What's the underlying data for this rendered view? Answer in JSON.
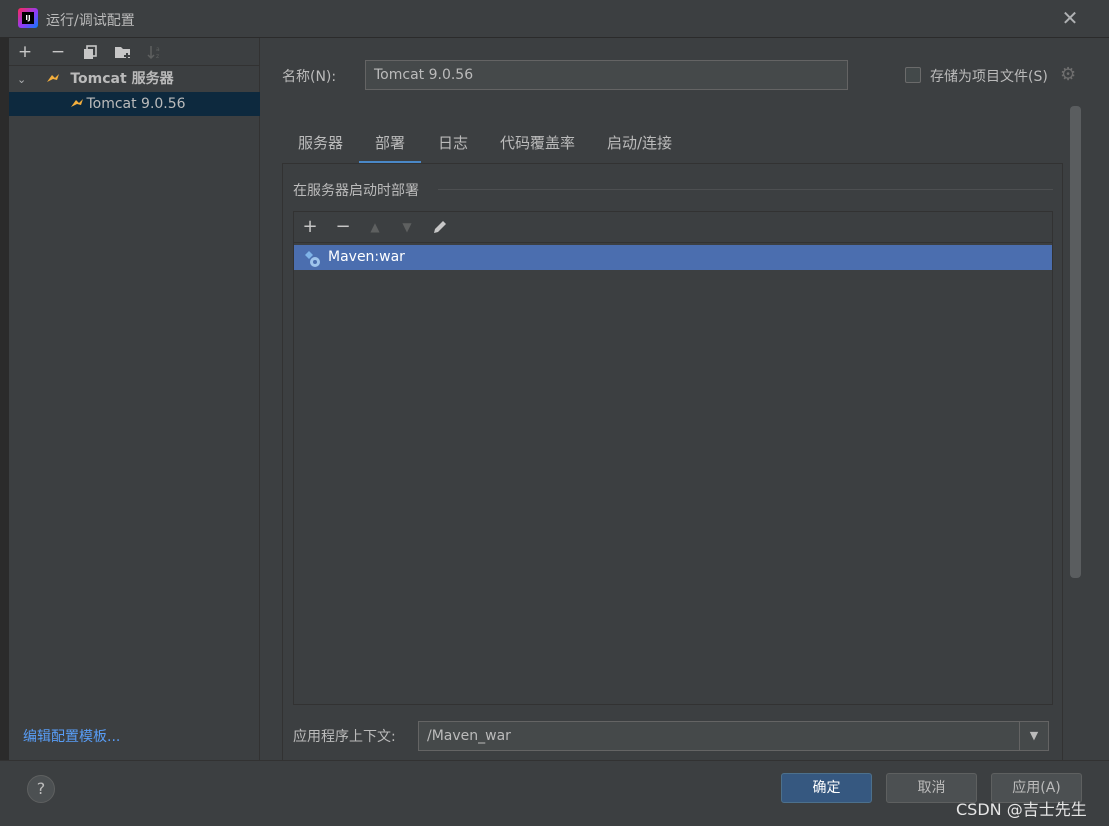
{
  "window": {
    "title": "运行/调试配置",
    "app_icon_text": "IJ"
  },
  "sidebar": {
    "toolbar": [
      "add",
      "remove",
      "copy",
      "new-folder",
      "sort"
    ],
    "tree": {
      "group_label": "Tomcat 服务器",
      "child_label": "Tomcat 9.0.56"
    },
    "edit_templates_link": "编辑配置模板..."
  },
  "form": {
    "name_label": "名称(N):",
    "name_value": "Tomcat 9.0.56",
    "store_label": "存储为项目文件(S)",
    "store_checked": false
  },
  "tabs": [
    {
      "label": "服务器",
      "active": false
    },
    {
      "label": "部署",
      "active": true
    },
    {
      "label": "日志",
      "active": false
    },
    {
      "label": "代码覆盖率",
      "active": false
    },
    {
      "label": "启动/连接",
      "active": false
    }
  ],
  "deploy": {
    "section_label": "在服务器启动时部署",
    "artifacts": [
      "Maven:war"
    ],
    "context_label": "应用程序上下文:",
    "context_value": "/Maven_war"
  },
  "buttons": {
    "help": "?",
    "ok": "确定",
    "cancel": "取消",
    "apply": "应用(A)"
  },
  "watermark": "CSDN @吉士先生",
  "colors": {
    "background": "#3c3f41",
    "selection": "#4b6eaf",
    "tree_selection": "#0d293e",
    "link": "#589df6",
    "primary_button": "#365880",
    "tab_underline": "#4a88c7"
  }
}
